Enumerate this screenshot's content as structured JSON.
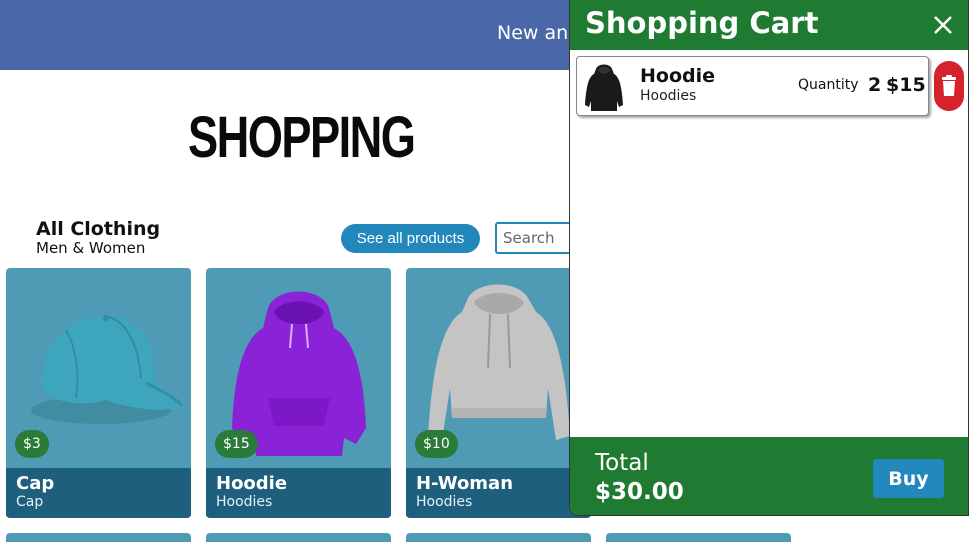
{
  "banner": {
    "text": "New and"
  },
  "page": {
    "title": "SHOPPING"
  },
  "section": {
    "title": "All Clothing",
    "subtitle": "Men & Women"
  },
  "toolbar": {
    "see_all_label": "See all products",
    "search_placeholder": "Search"
  },
  "products": [
    {
      "name": "Cap",
      "category": "Cap",
      "price": "$3",
      "image": "cap-icon",
      "color": "#3d9bb0"
    },
    {
      "name": "Hoodie",
      "category": "Hoodies",
      "price": "$15",
      "image": "hoodie-icon",
      "color": "#8a22d8"
    },
    {
      "name": "H-Woman",
      "category": "Hoodies",
      "price": "$10",
      "image": "crop-hoodie-icon",
      "color": "#bdbdbd"
    }
  ],
  "cart": {
    "title": "Shopping Cart",
    "close_icon": "close-icon",
    "items": [
      {
        "name": "Hoodie",
        "category": "Hoodies",
        "quantity_label": "Quantity",
        "quantity": "2",
        "price": "$15",
        "image": "black-hoodie-icon"
      }
    ],
    "total_label": "Total",
    "total_value": "$30.00",
    "buy_label": "Buy"
  },
  "colors": {
    "banner": "#4a67a8",
    "cart_header": "#1f7a32",
    "accent": "#2288bb",
    "card": "#4f9bb5",
    "card_caption": "#1f5f7e",
    "price_badge": "#2a7a3a",
    "delete": "#d6222a"
  }
}
